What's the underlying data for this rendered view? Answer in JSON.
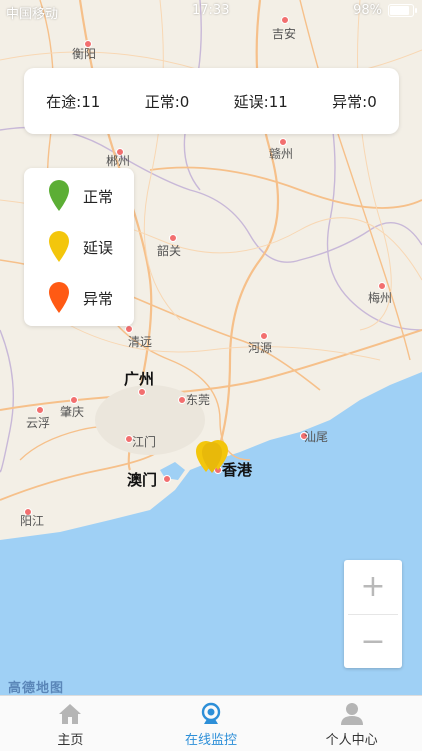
{
  "status_bar": {
    "carrier": "中国移动",
    "time": "17:33",
    "battery": "98%",
    "wifi_icon": "wifi-icon"
  },
  "summary": {
    "in_transit": "在途:11",
    "normal": "正常:0",
    "delayed": "延误:11",
    "abnormal": "异常:0"
  },
  "legend": {
    "items": [
      {
        "label": "正常",
        "color": "#5cae35"
      },
      {
        "label": "延误",
        "color": "#f3c60c"
      },
      {
        "label": "异常",
        "color": "#ff5a14"
      }
    ]
  },
  "map": {
    "places": {
      "hengyang": "衡阳",
      "jian": "吉安",
      "chenzhou": "郴州",
      "ganzhou": "赣州",
      "shaoguan": "韶关",
      "meizhou": "梅州",
      "qingyuan": "清远",
      "heyuan": "河源",
      "guangzhou": "广州",
      "dongguan": "东莞",
      "zhaoqing": "肇庆",
      "yunfu": "云浮",
      "jiangmen": "江门",
      "shanwei": "汕尾",
      "macau": "澳门",
      "hongkong": "香港",
      "yangjiang": "阳江"
    },
    "zoom_in": "+",
    "zoom_out": "−",
    "provider_logo": "高德地图",
    "marker_color": "#f3c60c",
    "sea_color": "#9fd0f5"
  },
  "tabs": [
    {
      "label": "主页",
      "icon": "home-icon",
      "active": false
    },
    {
      "label": "在线监控",
      "icon": "monitor-icon",
      "active": true
    },
    {
      "label": "个人中心",
      "icon": "user-icon",
      "active": false
    }
  ],
  "colors": {
    "accent": "#2d8fd8",
    "land": "#f3efe6",
    "roads": "#f6c08a"
  }
}
